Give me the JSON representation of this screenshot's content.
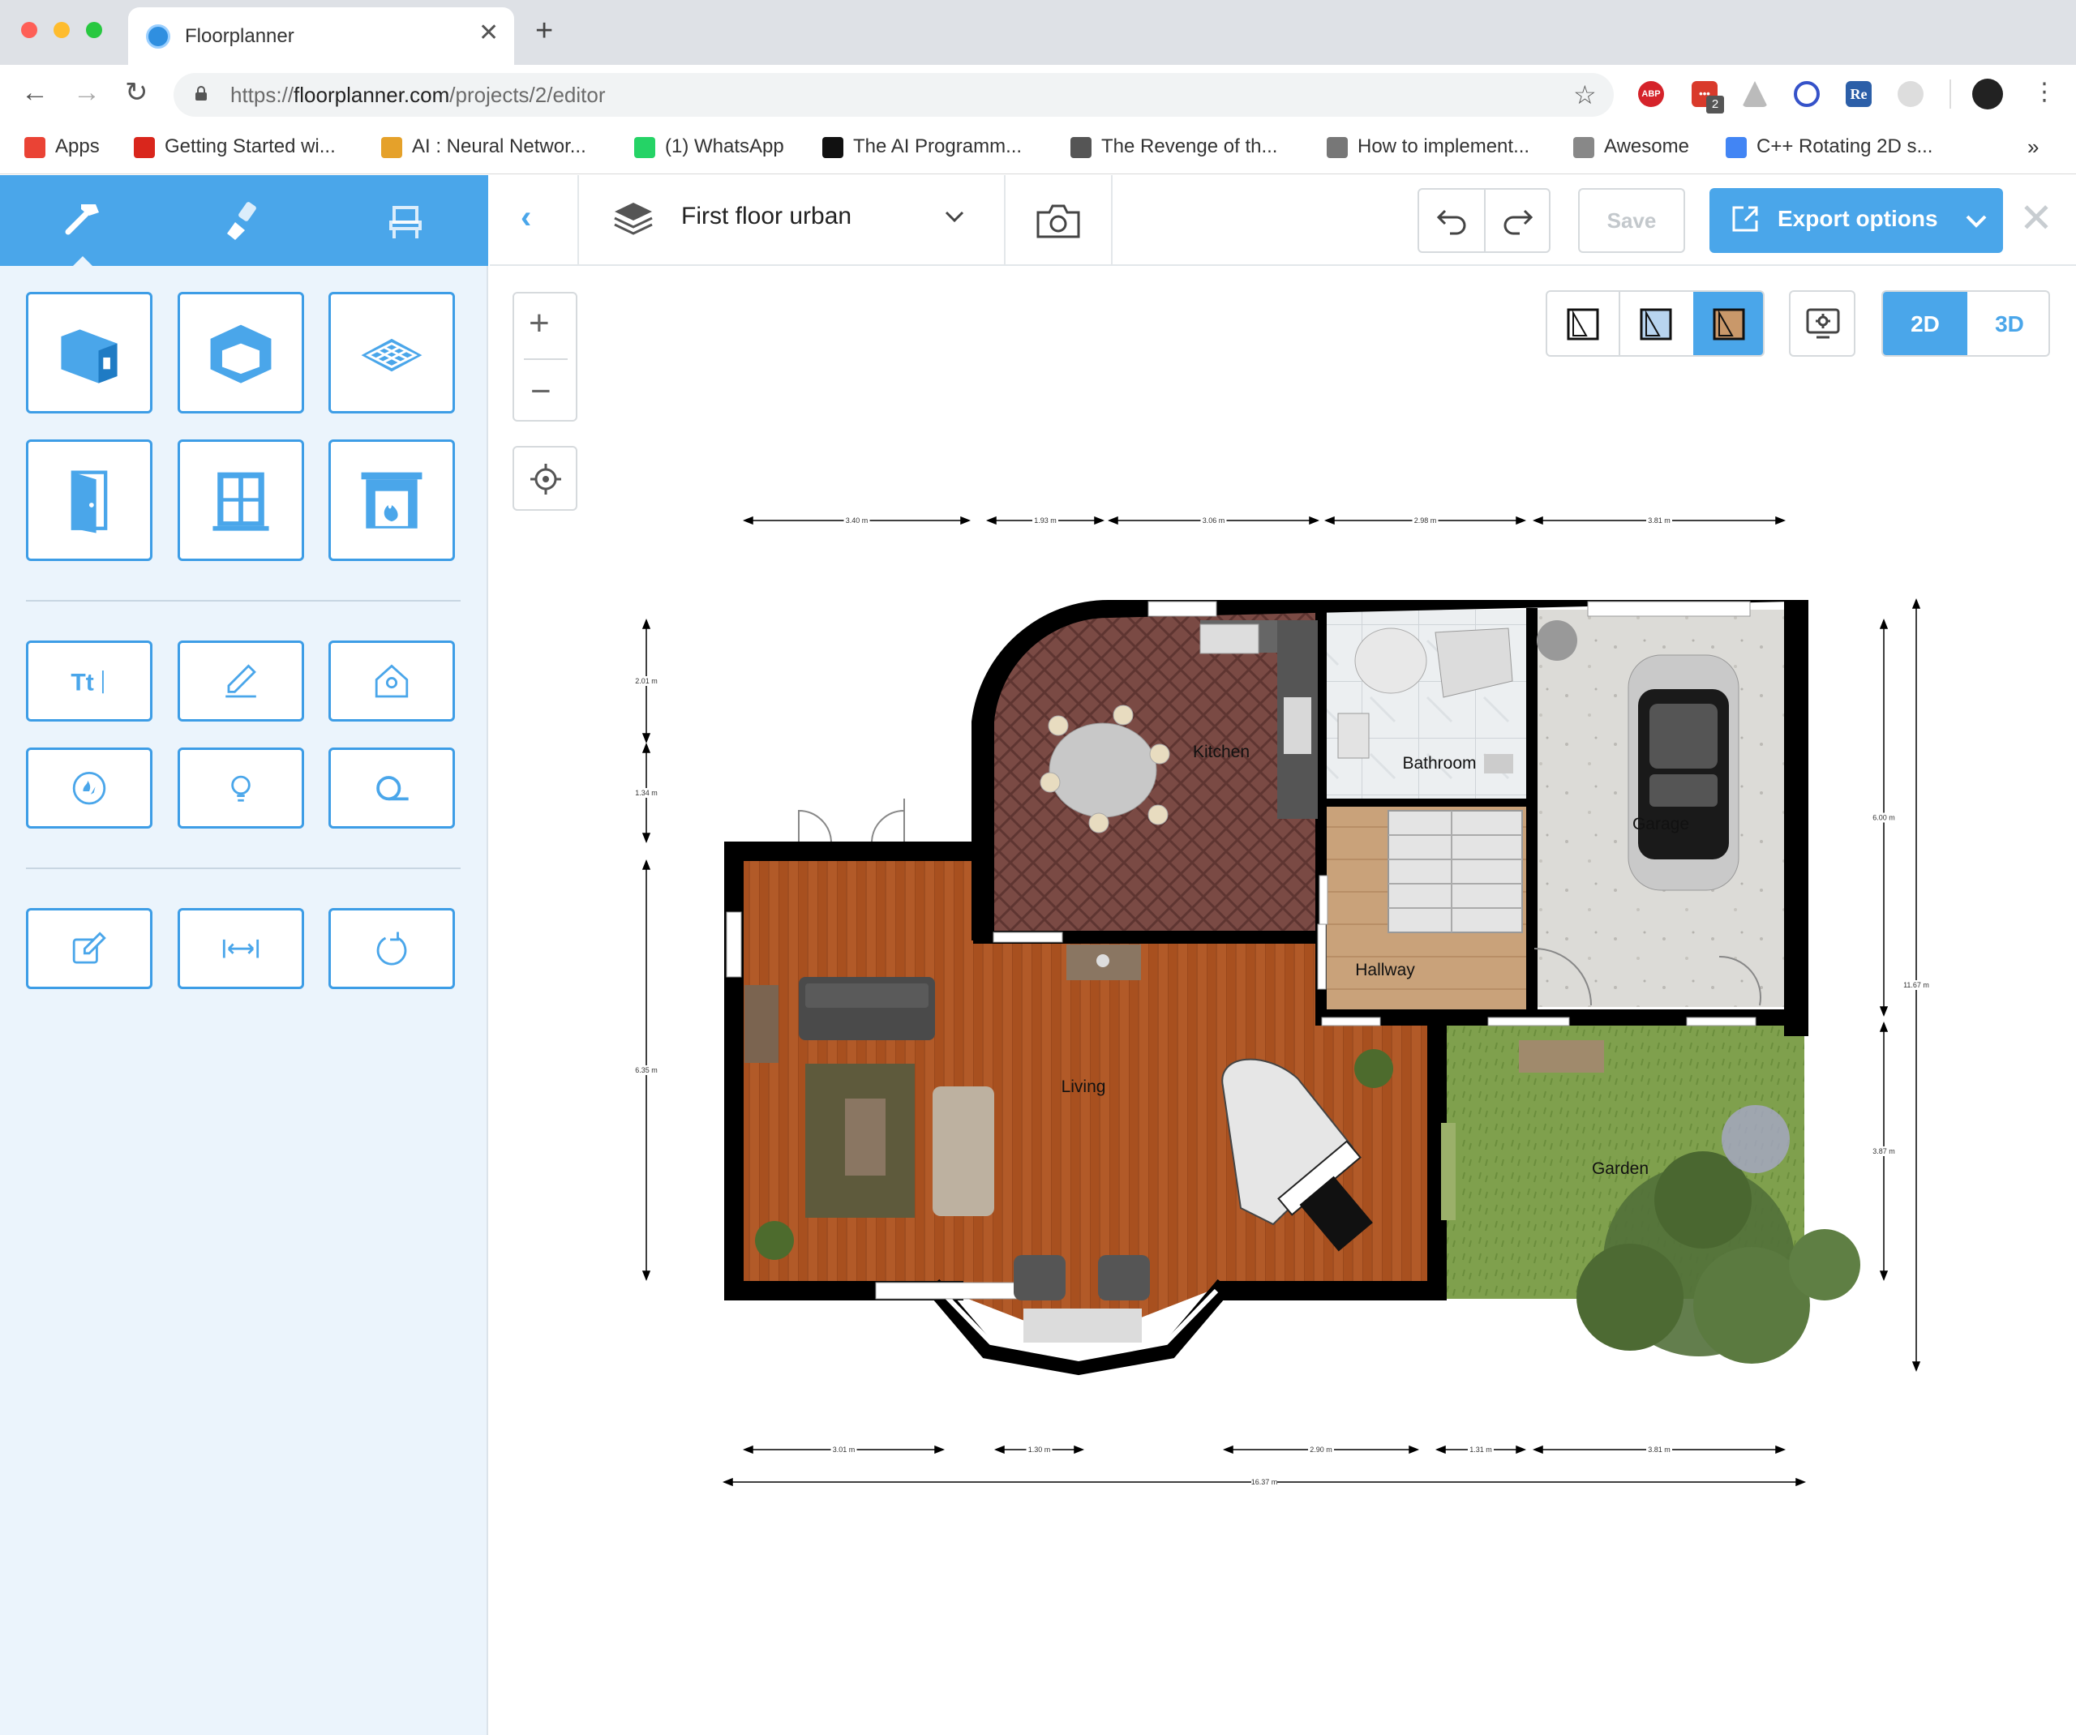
{
  "browser": {
    "tab_title": "Floorplanner",
    "url_domain": "floorplanner.com",
    "url_prefix": "https://",
    "url_path": "/projects/2/editor",
    "extension_badge": "2",
    "bookmarks": [
      {
        "label": "Apps",
        "color": "#ea4335"
      },
      {
        "label": "Getting Started wi...",
        "color": "#d9261c"
      },
      {
        "label": "AI : Neural Networ...",
        "color": "#e5a12a"
      },
      {
        "label": "(1) WhatsApp",
        "color": "#25d366"
      },
      {
        "label": "The AI Programm...",
        "color": "#111111"
      },
      {
        "label": "The Revenge of th...",
        "color": "#555555"
      },
      {
        "label": "How to implement...",
        "color": "#777777"
      },
      {
        "label": "Awesome",
        "color": "#888888"
      },
      {
        "label": "C++ Rotating 2D s...",
        "color": "#4285f4"
      }
    ],
    "more_bookmarks": "»"
  },
  "editor": {
    "floor_name": "First floor urban",
    "save_label": "Save",
    "export_label": "Export options",
    "mode_2d": "2D",
    "mode_3d": "3D",
    "accent": "#4aa6ea"
  },
  "sidebar": {
    "tabs": [
      "hammer-icon",
      "paint-brush-icon",
      "chair-icon"
    ],
    "tools_construction": [
      "wall-icon",
      "room-icon",
      "floor-tiles-icon",
      "door-icon",
      "window-icon",
      "fireplace-icon"
    ],
    "tools_annotate": [
      "text-icon",
      "pencil-icon",
      "map-marker-icon",
      "utility-icon",
      "light-bulb-icon",
      "measure-tape-icon"
    ],
    "tools_edit": [
      "edit-icon",
      "dimension-icon",
      "rotate-icon"
    ]
  },
  "plan": {
    "rooms": [
      "Kitchen",
      "Bathroom",
      "Garage",
      "Hallway",
      "Living",
      "Garden"
    ],
    "dimensions_top": [
      "3.40 m",
      "1.93 m",
      "3.06 m",
      "2.98 m",
      "3.81 m"
    ],
    "dimensions_bottom": [
      "3.01 m",
      "1.30 m",
      "2.90 m",
      "1.31 m",
      "3.81 m"
    ],
    "dimension_total_bottom": "16.37 m",
    "dimensions_left": [
      "2.01 m",
      "1.34 m",
      "6.35 m"
    ],
    "dimensions_right": [
      "6.00 m",
      "3.87 m"
    ],
    "dimension_total_right": "11.67 m"
  }
}
